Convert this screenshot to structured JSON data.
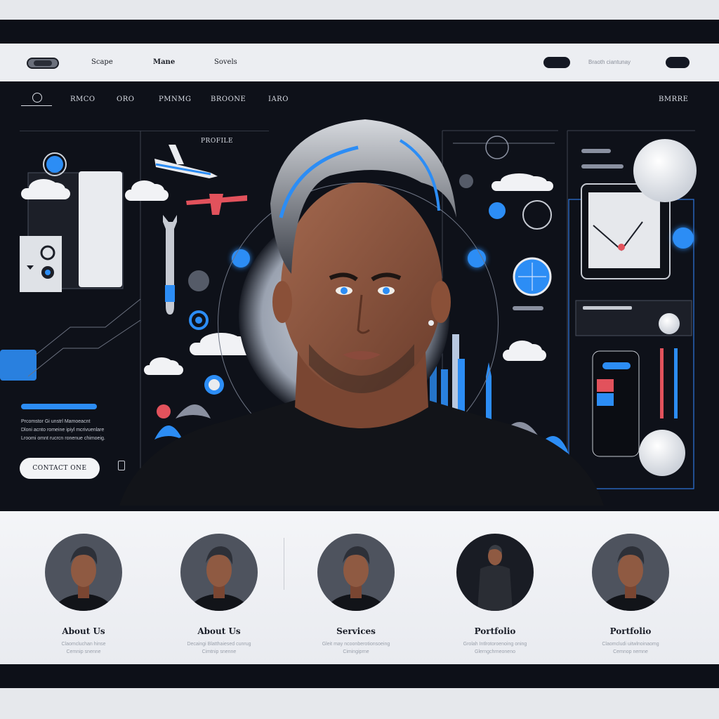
{
  "topbar": {
    "logo": "logo",
    "nav": [
      "Scape",
      "Mane",
      "Sovels"
    ],
    "right_text": "Braoth ciantunay"
  },
  "hero_nav": {
    "items": [
      "RMCO",
      "ORO",
      "PMNMG",
      "BROONE",
      "IARO"
    ],
    "right_label": "BMRRE"
  },
  "hero": {
    "profile_label": "PROFILE",
    "left_text_lines": [
      "Prcomstor Gi unstrl Mamoeacnt",
      "Dloni acnto romeine ipiyl mcrivuenlare",
      "Lroomi omnt rucrcn ronenue chimoeig."
    ],
    "contact_button": "CONTACT ONE"
  },
  "cards": [
    {
      "title": "About Us",
      "subtitle": "Claomcluchan hinse",
      "subtitle2": "Cemnip snenne"
    },
    {
      "title": "About Us",
      "subtitle": "Decaingi Blatthaiesed cunrug",
      "subtitle2": "Cimtnip snenne"
    },
    {
      "title": "Services",
      "subtitle": "Gleit may ncoonberotionsoeing",
      "subtitle2": "Cimingiprne"
    },
    {
      "title": "Portfolio",
      "subtitle": "Grolah Intlrotoroenoing oning",
      "subtitle2": "Glerngchrneoneno"
    },
    {
      "title": "Portfolio",
      "subtitle": "Claomcludi uitwlnoinaomg",
      "subtitle2": "Cemnop nemne"
    }
  ],
  "colors": {
    "accent": "#2c8df5",
    "hero_bg": "#0e1119",
    "secondary": "#e2525c"
  }
}
